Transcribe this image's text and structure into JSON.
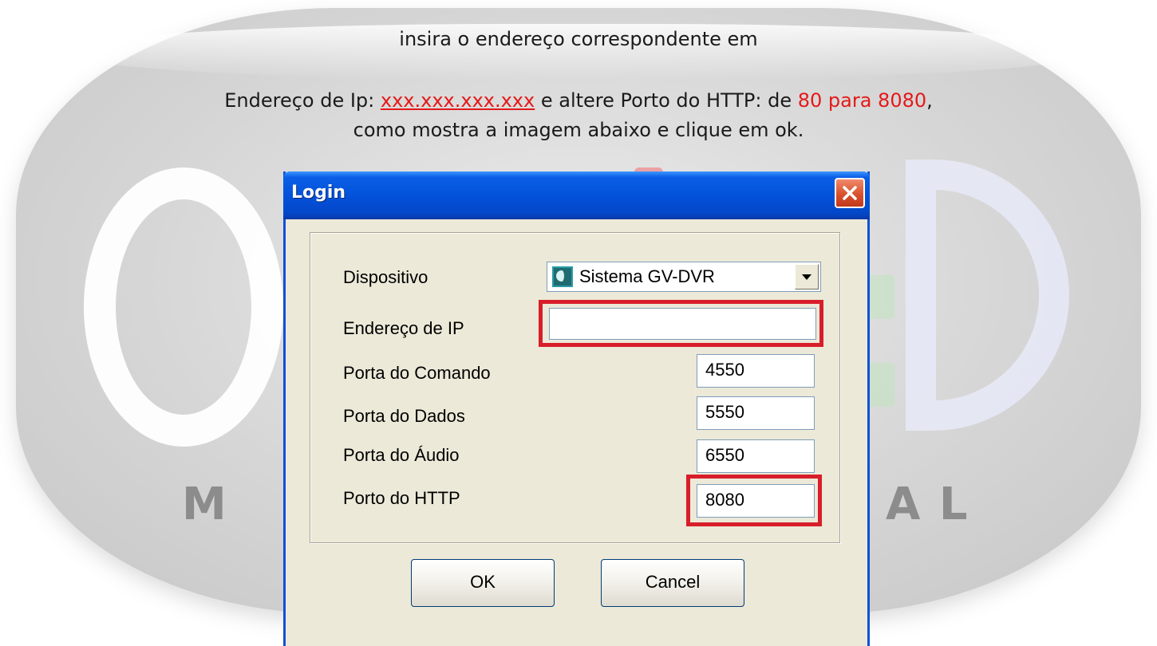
{
  "instructions": {
    "line1": "insira o endereço correspondente em",
    "line2_prefix": "Endereço de Ip: ",
    "line2_ip": "xxx.xxx.xxx.xxx",
    "line2_middle": " e altere Porto do HTTP: de ",
    "line2_ports": "80 para 8080",
    "line2_suffix": ",",
    "line3": "como mostra a imagem abaixo e clique em ok."
  },
  "watermark": {
    "left_letter": "M",
    "right_letters": "A L"
  },
  "dialog": {
    "title": "Login",
    "fields": {
      "device_label": "Dispositivo",
      "device_value": "Sistema GV-DVR",
      "ip_label": "Endereço de IP",
      "ip_value": "",
      "command_port_label": "Porta do Comando",
      "command_port_value": "4550",
      "data_port_label": "Porta do Dados",
      "data_port_value": "5550",
      "audio_port_label": "Porta do Áudio",
      "audio_port_value": "6550",
      "http_port_label": "Porto do HTTP",
      "http_port_value": "8080"
    },
    "ok_label": "OK",
    "cancel_label": "Cancel"
  },
  "colors": {
    "highlight": "#d81e2a",
    "instruction_red": "#e51919",
    "titlebar_blue": "#0350d8",
    "dialog_face": "#ece9d8"
  }
}
